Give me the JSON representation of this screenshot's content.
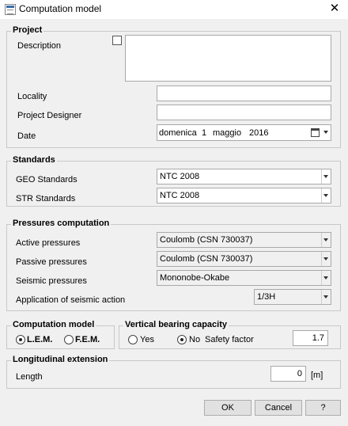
{
  "window": {
    "title": "Computation model",
    "close_glyph": "✕"
  },
  "project": {
    "title": "Project",
    "description_label": "Description",
    "description_value": "",
    "locality_label": "Locality",
    "locality_value": "",
    "designer_label": "Project Designer",
    "designer_value": "",
    "date_label": "Date",
    "date_weekday": "domenica",
    "date_day": "1",
    "date_month": "maggio",
    "date_year": "2016"
  },
  "standards": {
    "title": "Standards",
    "geo_label": "GEO Standards",
    "geo_value": "NTC 2008",
    "str_label": "STR Standards",
    "str_value": "NTC 2008"
  },
  "pressures": {
    "title": "Pressures computation",
    "active_label": "Active pressures",
    "active_value": "Coulomb (CSN 730037)",
    "passive_label": "Passive pressures",
    "passive_value": "Coulomb (CSN 730037)",
    "seismic_label": "Seismic pressures",
    "seismic_value": "Mononobe-Okabe",
    "application_label": "Application of seismic action",
    "application_value": "1/3H"
  },
  "computation_model": {
    "title": "Computation model",
    "lem_label": "L.E.M.",
    "fem_label": "F.E.M.",
    "selected": "L.E.M."
  },
  "vertical_bearing": {
    "title": "Vertical bearing capacity",
    "yes_label": "Yes",
    "no_label": "No",
    "selected": "No",
    "safety_factor_label": "Safety factor",
    "safety_factor_value": "1.7"
  },
  "longitudinal": {
    "title": "Longitudinal extension",
    "length_label": "Length",
    "length_value": "0",
    "length_unit": "[m]"
  },
  "buttons": {
    "ok": "OK",
    "cancel": "Cancel",
    "help": "?"
  }
}
